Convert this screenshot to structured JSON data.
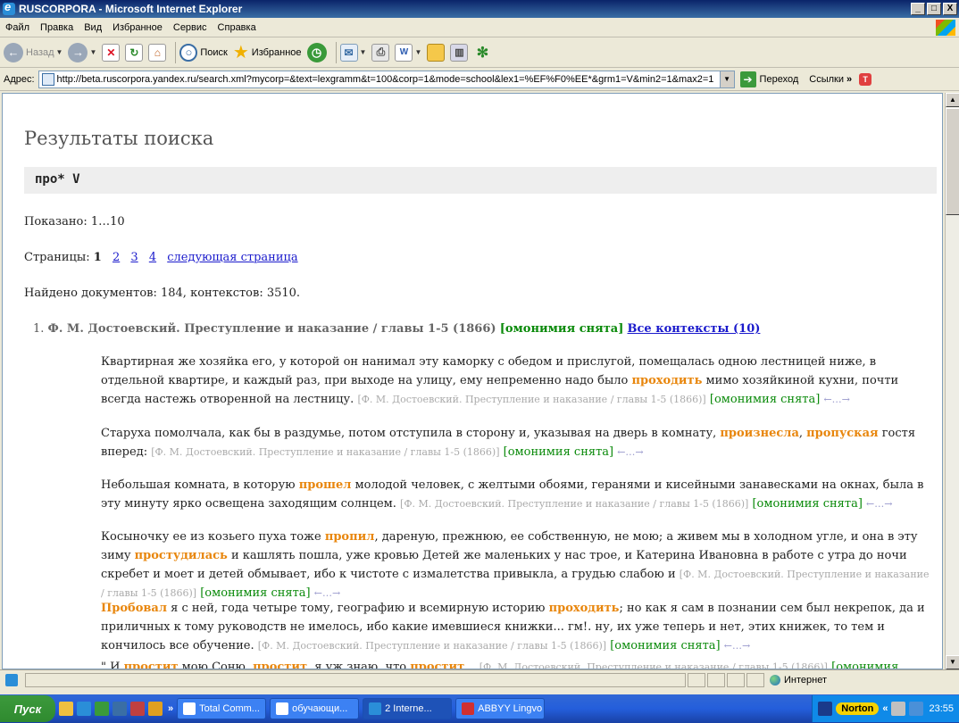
{
  "window": {
    "title": "RUSCORPORA - Microsoft Internet Explorer",
    "caption_buttons": [
      "_",
      "□",
      "X"
    ]
  },
  "menu": [
    "Файл",
    "Правка",
    "Вид",
    "Избранное",
    "Сервис",
    "Справка"
  ],
  "toolbar": {
    "back_label": "Назад",
    "search_label": "Поиск",
    "favorites_label": "Избранное"
  },
  "address": {
    "label": "Адрес:",
    "url": "http://beta.ruscorpora.yandex.ru/search.xml?mycorp=&text=lexgramm&t=100&corp=1&mode=school&lex1=%EF%F0%EE*&grm1=V&min2=1&max2=1",
    "go_label": "Переход",
    "links_label": "Ссылки"
  },
  "page": {
    "heading": "Результаты поиска",
    "query": "про* V",
    "shown": "Показано: 1…10",
    "pages_label": "Страницы:",
    "pages": [
      "1",
      "2",
      "3",
      "4"
    ],
    "next_page": "следующая страница",
    "found": "Найдено документов: 184, контекстов: 3510.",
    "result": {
      "number": "1.",
      "title": "Ф. М. Достоевский. Преступление и наказание / главы 1-5 (1866)",
      "homonymy": "[омонимия снята]",
      "all_contexts": "Все контексты (10)"
    },
    "source_ref": "[Ф. М. Достоевский. Преступление и наказание / главы 1-5 (1866)]",
    "homonymy_note": "[омонимия снята]",
    "nav_arrows": "←…→",
    "paragraphs": [
      {
        "t1": "Квартирная же хозяйка его, у которой он нанимал эту каморку с обедом и прислугой, помещалась одною лестницей ниже, в отдельной квартире, и каждый раз, при выходе на улицу, ему непременно надо было ",
        "h1": "проходить",
        "t2": " мимо хозяйкиной кухни, почти всегда настежь отворенной на лестницу. "
      },
      {
        "t1": "Старуха помолчала, как бы в раздумье, потом отступила в сторону и, указывая на дверь в комнату, ",
        "h1": "произнесла",
        "t2": ", ",
        "h2": "пропуская",
        "t3": " гостя вперед: "
      },
      {
        "t1": "Небольшая комната, в которую ",
        "h1": "прошел",
        "t2": " молодой человек, с желтыми обоями, геранями и кисейными занавесками на окнах, была в эту минуту ярко освещена заходящим солнцем. "
      },
      {
        "t1": "Косыночку ее из козьего пуха тоже ",
        "h1": "пропил",
        "t2": ", дареную, прежнюю, ее собственную, не мою; а живем мы в холодном угле, и она в эту зиму ",
        "h2": "простудилась",
        "t3": " и кашлять пошла, уже кровью Детей же маленьких у нас трое, и Катерина Ивановна в работе с утра до ночи скребет и моет и детей обмывает, ибо к чистоте с измалетства привыкла, а грудью слабою и "
      },
      {
        "h0": "Пробовал",
        "t1": " я с ней, года четыре тому, географию и всемирную историю ",
        "h1": "проходить",
        "t2": "; но как я сам в познании сем был некрепок, да и приличных к тому руководств не имелось, ибо какие имевшиеся книжки... гм!. ну, их уже теперь и нет, этих книжек, то тем и кончилось все обучение. "
      },
      {
        "t0": "\" И ",
        "h0": "простит",
        "t1": " мою Соню, ",
        "h1": "простит",
        "t2": ", я уж знаю, что ",
        "h2": "простит",
        "t3": "... ",
        "tail": "[омонимия"
      }
    ]
  },
  "status": {
    "zone": "Интернет"
  },
  "taskbar": {
    "start": "Пуск",
    "chevron": "»",
    "tasks": [
      "Total Comm...",
      "обучающи...",
      "2 Interne...",
      "ABBYY Lingvo"
    ],
    "tray_more": "«",
    "norton": "Norton",
    "clock": "23:55"
  },
  "colors": {
    "highlight": "#e8860c",
    "homonymy": "#0a8a0a",
    "link": "#1a1acc",
    "source": "#aaaaaa"
  }
}
